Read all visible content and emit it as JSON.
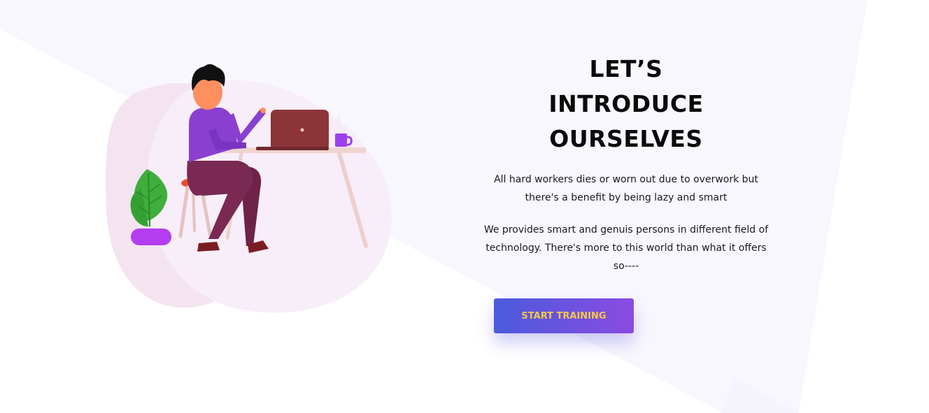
{
  "intro": {
    "heading_lines": [
      "LET’S",
      "INTRODUCE",
      "OURSELVES"
    ],
    "paragraph_1": "All hard workers dies or worn out due to overwork but there's a benefit by being lazy and smart",
    "paragraph_2": "We provides smart and genuis persons in different field of technology. There's more to this world than what it offers so----",
    "cta_label": "START TRAINING"
  },
  "illustration": {
    "icon": "person-working-at-laptop-illustration"
  },
  "colors": {
    "background_shape": "#f8f7fd",
    "blob": "#f5eaf6",
    "shirt": "#8a3fd1",
    "pants": "#7a2a52",
    "laptop": "#8a3438",
    "plant": "#3fae3a",
    "pot": "#b43df0",
    "cta_gradient_start": "#4a5bdc",
    "cta_gradient_end": "#8a4be0",
    "cta_text": "#f5c84a"
  }
}
